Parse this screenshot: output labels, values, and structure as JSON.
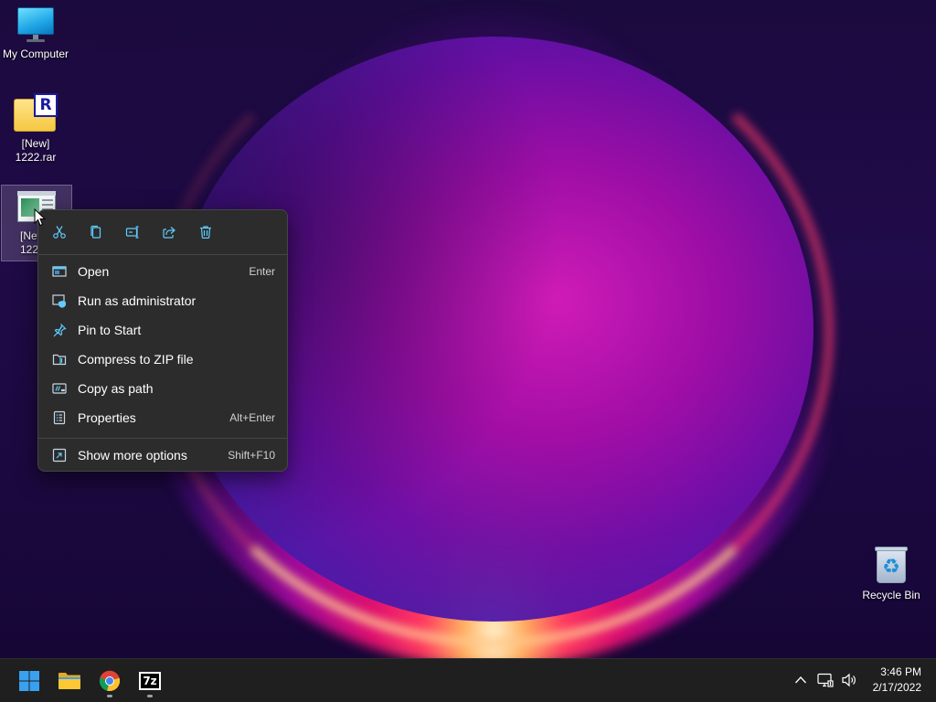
{
  "desktop": {
    "icons": [
      {
        "label": "My Computer",
        "icon": "monitor-icon"
      },
      {
        "label": "[New]\n1222.rar",
        "icon": "rar-archive-icon"
      },
      {
        "label": "[New\n1222",
        "icon": "application-icon"
      },
      {
        "label": "Recycle Bin",
        "icon": "recycle-bin-icon"
      }
    ]
  },
  "context_menu": {
    "toolbar": [
      {
        "name": "cut",
        "icon": "scissors-icon"
      },
      {
        "name": "copy",
        "icon": "copy-icon"
      },
      {
        "name": "rename",
        "icon": "rename-icon"
      },
      {
        "name": "share",
        "icon": "share-icon"
      },
      {
        "name": "delete",
        "icon": "trash-icon"
      }
    ],
    "items": [
      {
        "label": "Open",
        "accel": "Enter",
        "icon": "open-window-icon"
      },
      {
        "label": "Run as administrator",
        "accel": "",
        "icon": "shield-icon"
      },
      {
        "label": "Pin to Start",
        "accel": "",
        "icon": "pin-icon"
      },
      {
        "label": "Compress to ZIP file",
        "accel": "",
        "icon": "zip-folder-icon"
      },
      {
        "label": "Copy as path",
        "accel": "",
        "icon": "path-icon"
      },
      {
        "label": "Properties",
        "accel": "Alt+Enter",
        "icon": "properties-icon"
      },
      {
        "label": "Show more options",
        "accel": "Shift+F10",
        "icon": "more-options-icon"
      }
    ]
  },
  "taskbar": {
    "apps": [
      {
        "name": "start",
        "icon": "windows-start-icon"
      },
      {
        "name": "file-explorer",
        "icon": "folder-icon"
      },
      {
        "name": "chrome",
        "icon": "chrome-icon"
      },
      {
        "name": "7-zip",
        "icon": "sevenzip-icon",
        "glyph": "7z"
      }
    ],
    "tray": {
      "icons": [
        "chevron-up-icon",
        "network-icon",
        "volume-icon"
      ],
      "time": "3:46 PM",
      "date": "2/17/2022"
    }
  },
  "colors": {
    "menu_bg": "#2c2c2c",
    "menu_border": "#454545",
    "taskbar_bg": "#1f1f1f",
    "accent": "#60cdff"
  }
}
